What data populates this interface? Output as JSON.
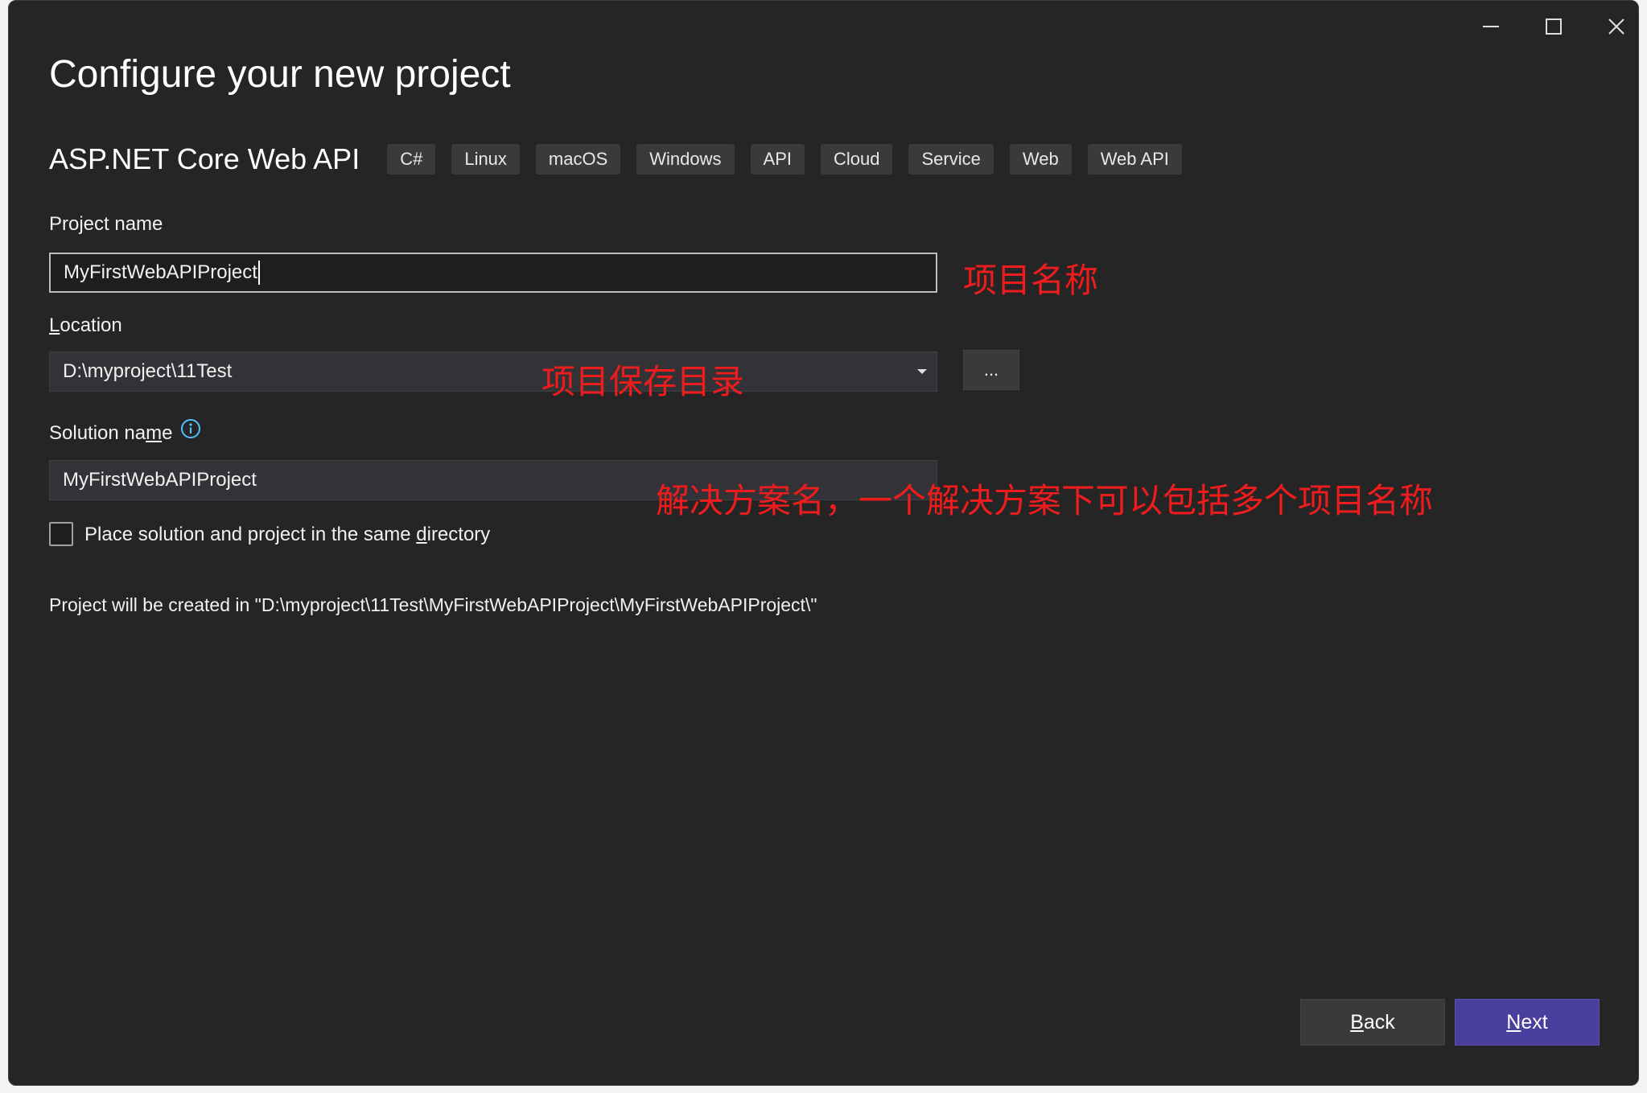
{
  "window": {
    "title": "Configure your new project",
    "controls": {
      "minimize": "minimize-icon",
      "maximize": "maximize-icon",
      "close": "close-icon"
    }
  },
  "template": {
    "name": "ASP.NET Core Web API",
    "tags": [
      "C#",
      "Linux",
      "macOS",
      "Windows",
      "API",
      "Cloud",
      "Service",
      "Web",
      "Web API"
    ]
  },
  "form": {
    "project_name_label": "Project name",
    "project_name_value": "MyFirstWebAPIProject",
    "location_label": {
      "access_key": "L",
      "rest": "ocation"
    },
    "location_value": "D:\\myproject\\11Test",
    "browse_label": "...",
    "solution_name_label": {
      "before": "Solution na",
      "access_key": "m",
      "after": "e"
    },
    "solution_name_value": "MyFirstWebAPIProject",
    "same_dir_label": {
      "before": "Place solution and project in the same ",
      "access_key": "d",
      "after": "irectory"
    },
    "same_dir_checked": false,
    "created_in_text": "Project will be created in \"D:\\myproject\\11Test\\MyFirstWebAPIProject\\MyFirstWebAPIProject\\\""
  },
  "annotations": {
    "project_name": "项目名称",
    "location": "项目保存目录",
    "solution_name": "解决方案名，一个解决方案下可以包括多个项目名称"
  },
  "buttons": {
    "back": {
      "access_key": "B",
      "rest": "ack"
    },
    "next": {
      "access_key": "N",
      "rest": "ext"
    }
  },
  "colors": {
    "background": "#252526",
    "field": "#333337",
    "tag": "#3a3a3b",
    "accent": "#4b3f9e",
    "info": "#4fc1ff",
    "annotation": "#ee1c1c"
  }
}
